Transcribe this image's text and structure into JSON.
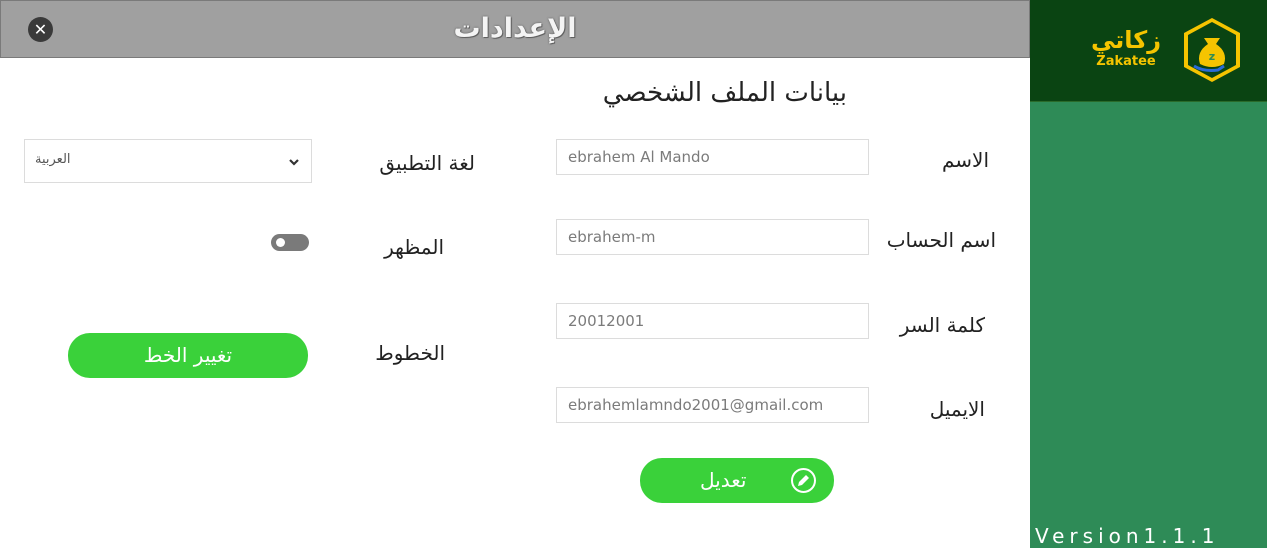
{
  "window": {
    "title": "الإعدادات",
    "close_icon": "close-icon"
  },
  "sidebar": {
    "logo_ar": "زكاتي",
    "logo_en": "Zakatee",
    "version": "Version1.1.1",
    "colors": {
      "sidebar_bg": "#2e8b57",
      "logo_bg": "#0a4412",
      "logo_accent": "#f5c400"
    }
  },
  "profile": {
    "heading": "بيانات الملف الشخصي",
    "name_label": "الاسم",
    "name_value": "ebrahem Al Mando",
    "username_label": "اسم الحساب",
    "username_value": "ebrahem-m",
    "password_label": "كلمة السر",
    "password_value": "20012001",
    "email_label": "الايميل",
    "email_value": "ebrahemlamndo2001@gmail.com",
    "edit_button": "تعديل",
    "edit_icon": "pencil-icon"
  },
  "settings": {
    "language_label": "لغة التطبيق",
    "language_value": "العربية",
    "appearance_label": "المظهر",
    "fonts_label": "الخطوط",
    "change_font_button": "تغيير الخط"
  },
  "colors": {
    "accent": "#3ad13a",
    "titlebar": "#a0a0a0"
  }
}
